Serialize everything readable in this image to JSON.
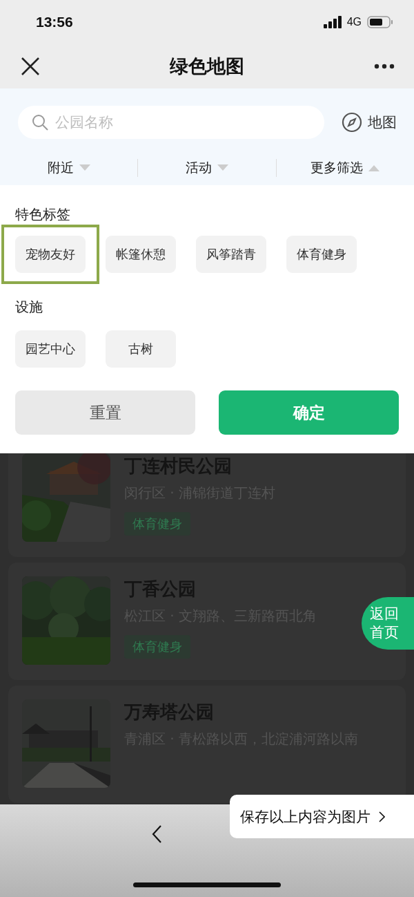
{
  "status_bar": {
    "time": "13:56",
    "network": "4G"
  },
  "nav": {
    "title": "绿色地图"
  },
  "search": {
    "placeholder": "公园名称",
    "map_button": "地图"
  },
  "filters": [
    {
      "label": "附近",
      "expanded": false
    },
    {
      "label": "活动",
      "expanded": false
    },
    {
      "label": "更多筛选",
      "expanded": true
    }
  ],
  "filter_panel": {
    "sections": [
      {
        "title": "特色标签",
        "tags": [
          {
            "label": "宠物友好",
            "highlighted": true
          },
          {
            "label": "帐篷休憩",
            "highlighted": false
          },
          {
            "label": "风筝踏青",
            "highlighted": false
          },
          {
            "label": "体育健身",
            "highlighted": false
          }
        ]
      },
      {
        "title": "设施",
        "tags": [
          {
            "label": "园艺中心",
            "highlighted": false
          },
          {
            "label": "古树",
            "highlighted": false
          }
        ]
      }
    ],
    "reset_button": "重置",
    "confirm_button": "确定"
  },
  "parks": [
    {
      "name": "丁连村民公园",
      "address": "闵行区 · 浦锦街道丁连村",
      "tags": [
        "体育健身"
      ]
    },
    {
      "name": "丁香公园",
      "address": "松江区 · 文翔路、三新路西北角",
      "tags": [
        "体育健身"
      ]
    },
    {
      "name": "万寿塔公园",
      "address": "青浦区 · 青松路以西，北淀浦河路以南"
    }
  ],
  "home_button": "返回首页",
  "save_popup": {
    "label": "保存以上内容为图片"
  }
}
